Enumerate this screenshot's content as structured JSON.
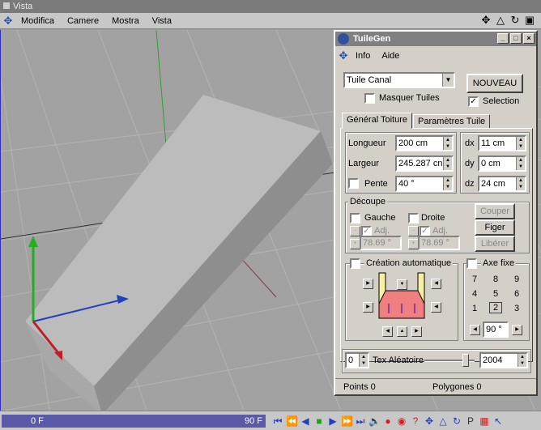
{
  "window": {
    "title": "Vista"
  },
  "menu": {
    "items": [
      "Modifica",
      "Camere",
      "Mostra",
      "Vista"
    ]
  },
  "view_tools": [
    "move-icon",
    "triangle-icon",
    "rotate-icon",
    "frame-icon"
  ],
  "timeline": {
    "frame_start": "0 F",
    "frame_end": "90 F"
  },
  "dialog": {
    "title": "TuileGen",
    "menu": [
      "Info",
      "Aide"
    ],
    "type_value": "Tuile Canal",
    "masquer_tuiles": "Masquer Tuiles",
    "nouveau_button": "NOUVEAU",
    "selection_label": "Selection",
    "selection_checked": true,
    "tabs": [
      "Général Toiture",
      "Paramètres Tuile"
    ],
    "fields": {
      "longueur_label": "Longueur",
      "longueur_value": "200 cm",
      "largeur_label": "Largeur",
      "largeur_value": "245.287 cn",
      "pente_label": "Pente",
      "pente_value": "40 °",
      "dx_label": "dx",
      "dx_value": "11 cm",
      "dy_label": "dy",
      "dy_value": "0 cm",
      "dz_label": "dz",
      "dz_value": "24 cm"
    },
    "decoupe": {
      "title": "Découpe",
      "gauche": "Gauche",
      "droite": "Droite",
      "adj": "Adj.",
      "gauche_angle": "78.69 °",
      "droite_angle": "78.69 °",
      "couper": "Couper",
      "figer": "Figer",
      "liberer": "Libérer"
    },
    "creation_auto": "Création automatique",
    "axe_fixe": "Axe fixe",
    "axe_grid": [
      "7",
      "8",
      "9",
      "4",
      "5",
      "6",
      "1",
      "2",
      "3"
    ],
    "axe_angle": "90 °",
    "tex_seed": "0",
    "tex_label": "Tex Aléatoire",
    "tex_value": "2004",
    "tex_slider": 0.82,
    "status_points": "Points 0",
    "status_polygones": "Polygones 0"
  },
  "colors": {
    "annotation": "#ff6a1a",
    "axis_y": "#20b020",
    "axis_x": "#2040c0",
    "axis_z": "#c02020"
  }
}
